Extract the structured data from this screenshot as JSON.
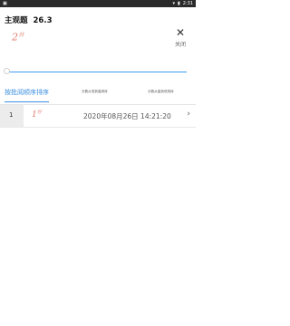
{
  "status_bar": {
    "time": "2:31",
    "left_icon": "notification-icon",
    "right_icons": [
      "wifi-icon",
      "battery-icon"
    ]
  },
  "header": {
    "title": "主观题",
    "score": "26.3"
  },
  "handwritten_preview": {
    "text": "2",
    "suffix": "分"
  },
  "close_button": {
    "icon": "close-icon",
    "label": "关闭"
  },
  "tabs": [
    {
      "label": "按批阅顺序排序",
      "active": true
    },
    {
      "label": "分数从低到高排序",
      "active": false
    },
    {
      "label": "分数从高到低排序",
      "active": false
    }
  ],
  "list": [
    {
      "index": "1",
      "thumb_text": "1",
      "thumb_suffix": "分",
      "time": "2020年08月26日 14:21:20"
    }
  ],
  "colors": {
    "accent": "#3d8fe0",
    "handwriting": "#e07b6a",
    "statusbar": "#2a2a2a"
  }
}
